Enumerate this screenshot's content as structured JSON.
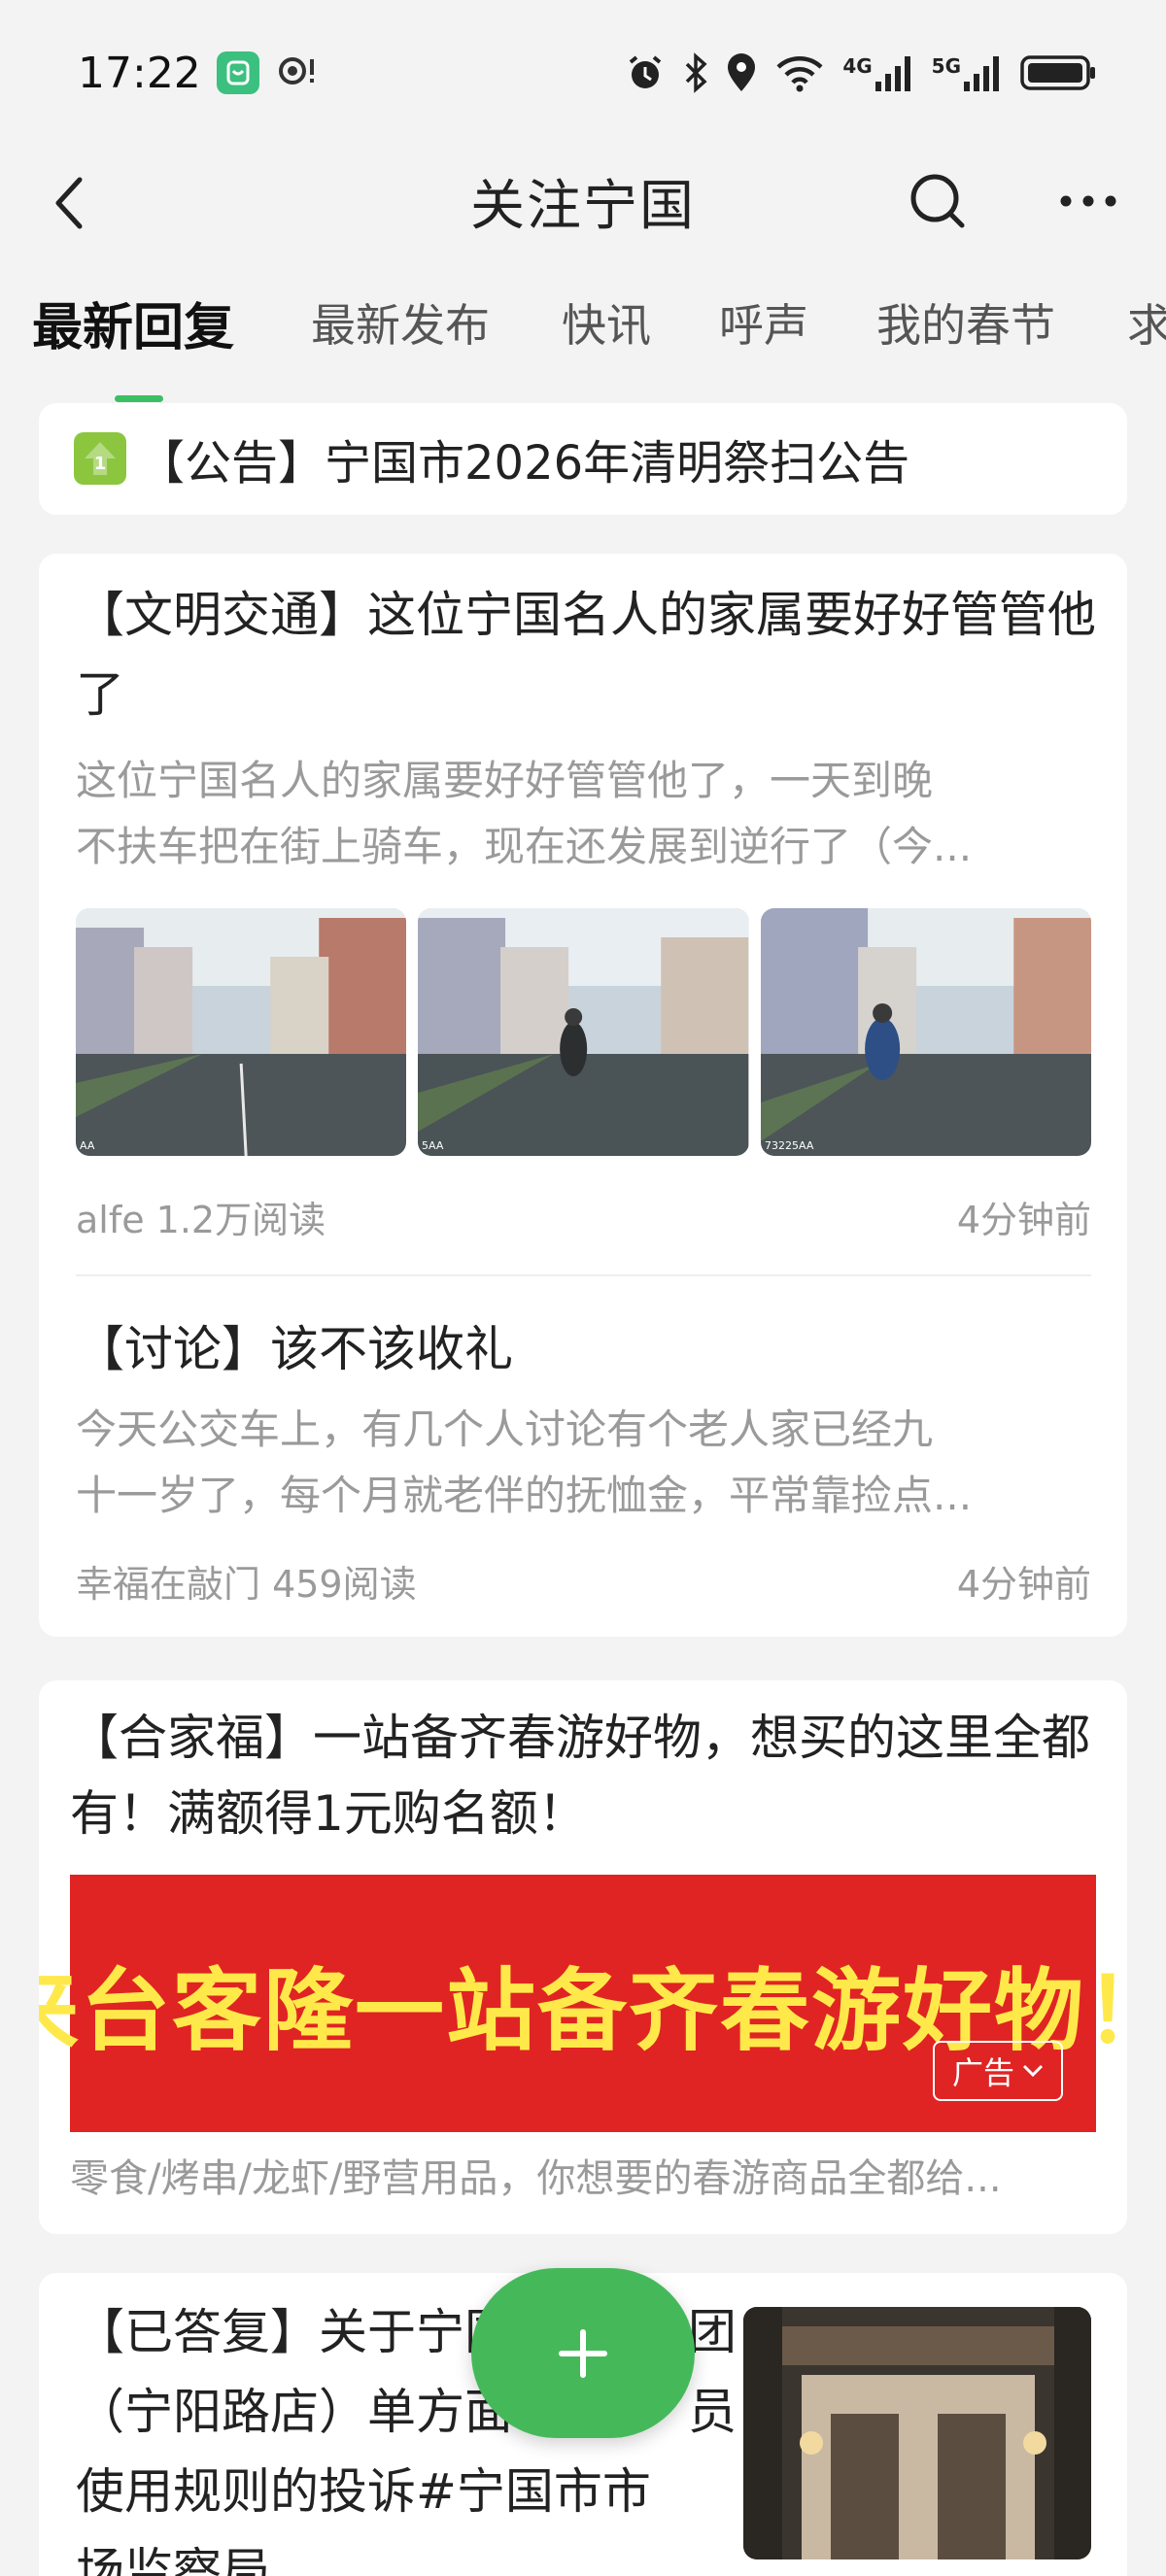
{
  "status_bar": {
    "time": "17:22",
    "network_1": "4G",
    "network_2": "5G",
    "icons": [
      "app-badge-icon",
      "hotspot-icon",
      "alarm-icon",
      "bluetooth-icon",
      "location-icon",
      "wifi-icon",
      "signal-icon",
      "battery-icon"
    ]
  },
  "header": {
    "title": "关注宁国",
    "icons": [
      "back-icon",
      "search-icon",
      "more-icon"
    ]
  },
  "tabs": [
    {
      "label": "最新回复",
      "active": true
    },
    {
      "label": "最新发布",
      "active": false
    },
    {
      "label": "快讯",
      "active": false
    },
    {
      "label": "呼声",
      "active": false
    },
    {
      "label": "我的春节",
      "active": false
    },
    {
      "label": "求",
      "active": false
    }
  ],
  "accent_color": "#3cbf62",
  "notice": {
    "text": "【公告】宁国市2026年清明祭扫公告",
    "icon": "pin-top-icon"
  },
  "posts": [
    {
      "title": "【文明交通】这位宁国名人的家属要好好管管他了",
      "excerpt_line1": "这位宁国名人的家属要好好管管他了，一天到晚",
      "excerpt_line2": "不扶车把在街上骑车，现在还发展到逆行了（今...",
      "thumb_captions": [
        "AA",
        "5AA",
        "73225AA"
      ],
      "author_reads": "alfe 1.2万阅读",
      "time": "4分钟前"
    },
    {
      "title": "【讨论】该不该收礼",
      "excerpt_line1": "今天公交车上，有几个人讨论有个老人家已经九",
      "excerpt_line2": "十一岁了，每个月就老伴的抚恤金，平常靠捡点...",
      "author_reads": "幸福在敲门 459阅读",
      "time": "4分钟前"
    }
  ],
  "ad": {
    "title_line1": "【合家福】一站备齐春游好物，想买的这里全都",
    "title_line2": "有！满额得1元购名额！",
    "banner_text": "来台客隆一站备齐春游好物！",
    "tag": "广告",
    "desc": "零食/烤串/龙虾/野营用品，你想要的春游商品全都给..."
  },
  "answer_post": {
    "line1": "【已答复】关于宁国",
    "line1_tail": "团",
    "line2_head": "（宁阳路店）单方面",
    "line2_tail": "员",
    "line3": "使用规则的投诉#宁国市市",
    "line4": "场监察局"
  },
  "fab": {
    "icon": "plus-icon"
  }
}
